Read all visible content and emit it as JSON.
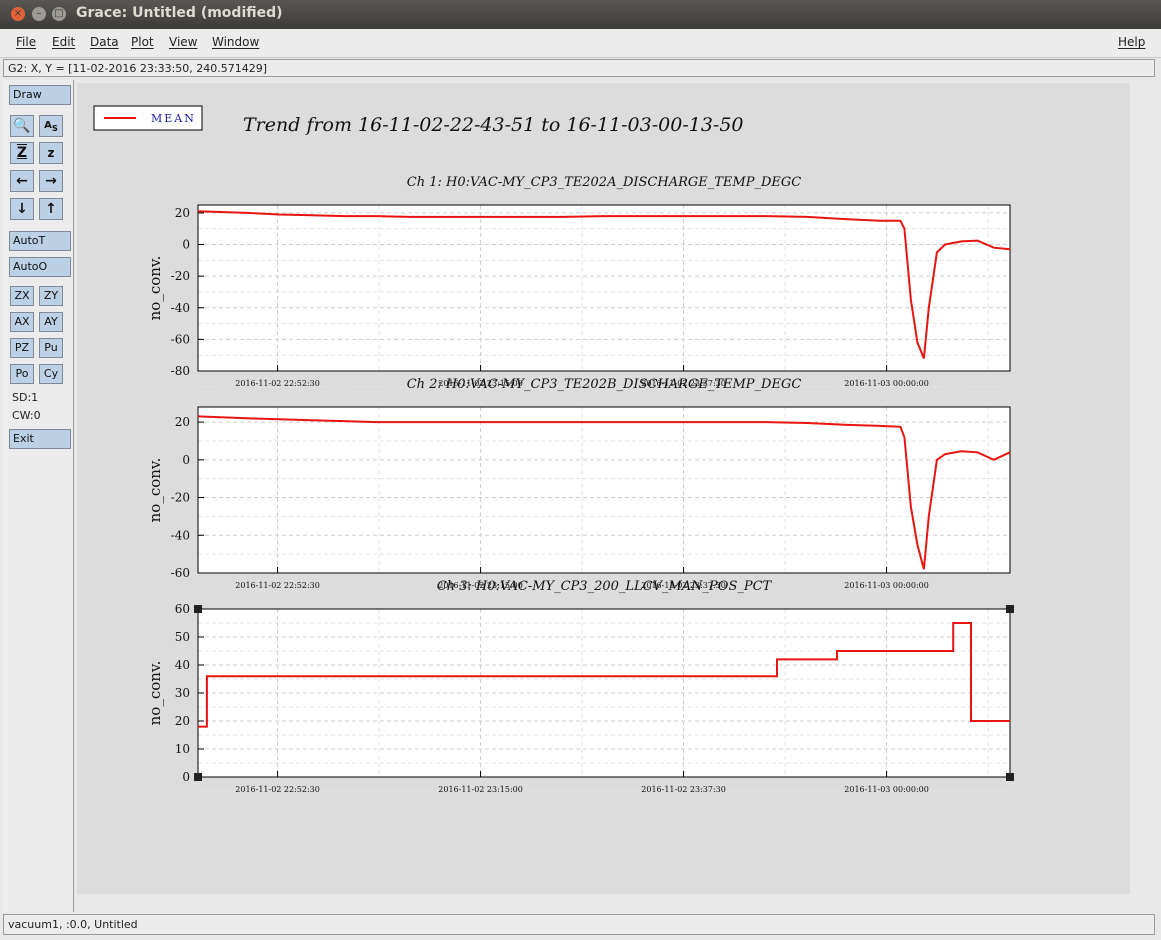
{
  "window": {
    "title": "Grace: Untitled (modified)"
  },
  "menu": {
    "file": "File",
    "edit": "Edit",
    "data": "Data",
    "plot": "Plot",
    "view": "View",
    "window": "Window",
    "help": "Help"
  },
  "locator": "G2: X, Y = [11-02-2016 23:33:50, 240.571429]",
  "toolbar": {
    "draw": "Draw",
    "autot": "AutoT",
    "autoo": "AutoO",
    "zx": "ZX",
    "zy": "ZY",
    "ax": "AX",
    "ay": "AY",
    "pz": "PZ",
    "pu": "Pu",
    "po": "Po",
    "cy": "Cy",
    "sd": "SD:1",
    "cw": "CW:0",
    "exit": "Exit",
    "icons": [
      "zoom-icon",
      "autoscale-text-icon",
      "zoom-z-icon",
      "zoom-z-small-icon",
      "arrow-left-icon",
      "arrow-right-icon",
      "arrow-down-icon",
      "arrow-up-icon"
    ]
  },
  "status": "vacuum1, :0.0, Untitled",
  "plot": {
    "title": "Trend from 16-11-02-22-43-51 to 16-11-03-00-13-50",
    "legend": "MEAN",
    "line_color": "#e8140f"
  },
  "chart_data": [
    {
      "type": "line",
      "title": "Ch 1: H0:VAC-MY_CP3_TE202A_DISCHARGE_TEMP_DEGC",
      "ylabel": "no_conv.",
      "ylim": [
        -80,
        25
      ],
      "yticks": [
        20,
        0,
        -20,
        -40,
        -60,
        -80
      ],
      "xticks": [
        "2016-11-02 22:52:30",
        "2016-11-02 23:15:00",
        "2016-11-02 23:37:30",
        "2016-11-03 00:00:00"
      ],
      "series": [
        {
          "name": "MEAN",
          "x": [
            0,
            6,
            10,
            14,
            18,
            22,
            26,
            30,
            35,
            40,
            45,
            50,
            55,
            60,
            65,
            70,
            75,
            80,
            84,
            86.5,
            87,
            87.8,
            88.6,
            89.4,
            90,
            91,
            92,
            94,
            96,
            98,
            100
          ],
          "y": [
            21,
            20,
            19,
            18.5,
            18,
            18,
            17.5,
            17.5,
            17.5,
            17.5,
            17.5,
            18,
            18,
            18,
            18,
            18,
            17.5,
            16,
            15,
            15,
            10,
            -35,
            -62,
            -72,
            -40,
            -5,
            0,
            2,
            2.5,
            -2,
            -3
          ]
        }
      ]
    },
    {
      "type": "line",
      "title": "Ch 2: H0:VAC-MY_CP3_TE202B_DISCHARGE_TEMP_DEGC",
      "ylabel": "no_conv.",
      "ylim": [
        -60,
        28
      ],
      "yticks": [
        20,
        0,
        -20,
        -40,
        -60
      ],
      "xticks": [
        "2016-11-02 22:52:30",
        "2016-11-02 23:15:00",
        "2016-11-02 23:37:30",
        "2016-11-03 00:00:00"
      ],
      "series": [
        {
          "name": "MEAN",
          "x": [
            0,
            6,
            10,
            14,
            18,
            22,
            26,
            30,
            35,
            40,
            45,
            50,
            55,
            60,
            65,
            70,
            75,
            80,
            84,
            86.5,
            87,
            87.8,
            88.6,
            89.4,
            90,
            91,
            92,
            94,
            96,
            98,
            100
          ],
          "y": [
            23,
            22,
            21.5,
            21,
            20.5,
            20,
            20,
            20,
            20,
            20,
            20,
            20,
            20,
            20,
            20,
            20,
            19.5,
            18.5,
            18,
            17.5,
            12,
            -25,
            -45,
            -58,
            -30,
            0,
            3,
            4.5,
            4,
            0,
            4
          ]
        }
      ]
    },
    {
      "type": "line",
      "title": "Ch 3: H0:VAC-MY_CP3_200_LLCV_MAN_POS_PCT",
      "ylabel": "no_conv.",
      "ylim": [
        0,
        60
      ],
      "yticks": [
        60,
        50,
        40,
        30,
        20,
        10,
        0
      ],
      "xticks": [
        "2016-11-02 22:52:30",
        "2016-11-02 23:15:00",
        "2016-11-02 23:37:30",
        "2016-11-03 00:00:00"
      ],
      "series": [
        {
          "name": "MEAN",
          "x": [
            0,
            1.1,
            1.1,
            71.3,
            71.3,
            78.7,
            78.7,
            93,
            93,
            95.2,
            95.2,
            100
          ],
          "y": [
            18,
            18,
            36,
            36,
            42,
            42,
            45,
            45,
            55,
            55,
            20,
            20
          ]
        }
      ]
    }
  ]
}
